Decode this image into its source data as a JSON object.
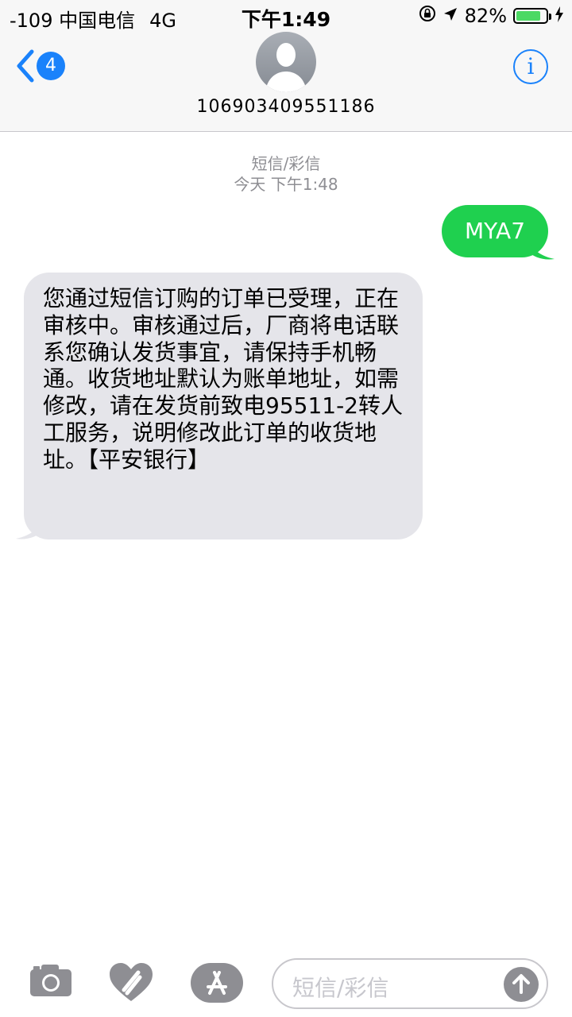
{
  "status_bar": {
    "carrier": "-109 中国电信",
    "network": "4G",
    "time": "下午1:49",
    "battery_percent": "82%",
    "battery_level": 0.82
  },
  "header": {
    "back_badge": "4",
    "contact": "106903409551186"
  },
  "conversation": {
    "type_label": "短信/彩信",
    "timestamp": "今天 下午1:48",
    "messages": [
      {
        "direction": "outgoing",
        "text": "MYA7"
      },
      {
        "direction": "incoming",
        "text": "您通过短信订购的订单已受理，正在审核中。审核通过后，厂商将电话联系您确认发货事宜，请保持手机畅通。收货地址默认为账单地址，如需修改，请在发货前致电95511-2转人工服务，说明修改此订单的收货地址。【平安银行】"
      }
    ]
  },
  "input_bar": {
    "placeholder": "短信/彩信",
    "icons": [
      "camera-icon",
      "digital-touch-icon",
      "app-store-icon",
      "send-arrow-icon"
    ]
  },
  "colors": {
    "accent": "#1a82fb",
    "outgoing_bubble": "#1fd04f",
    "incoming_bubble": "#e5e5ea"
  }
}
